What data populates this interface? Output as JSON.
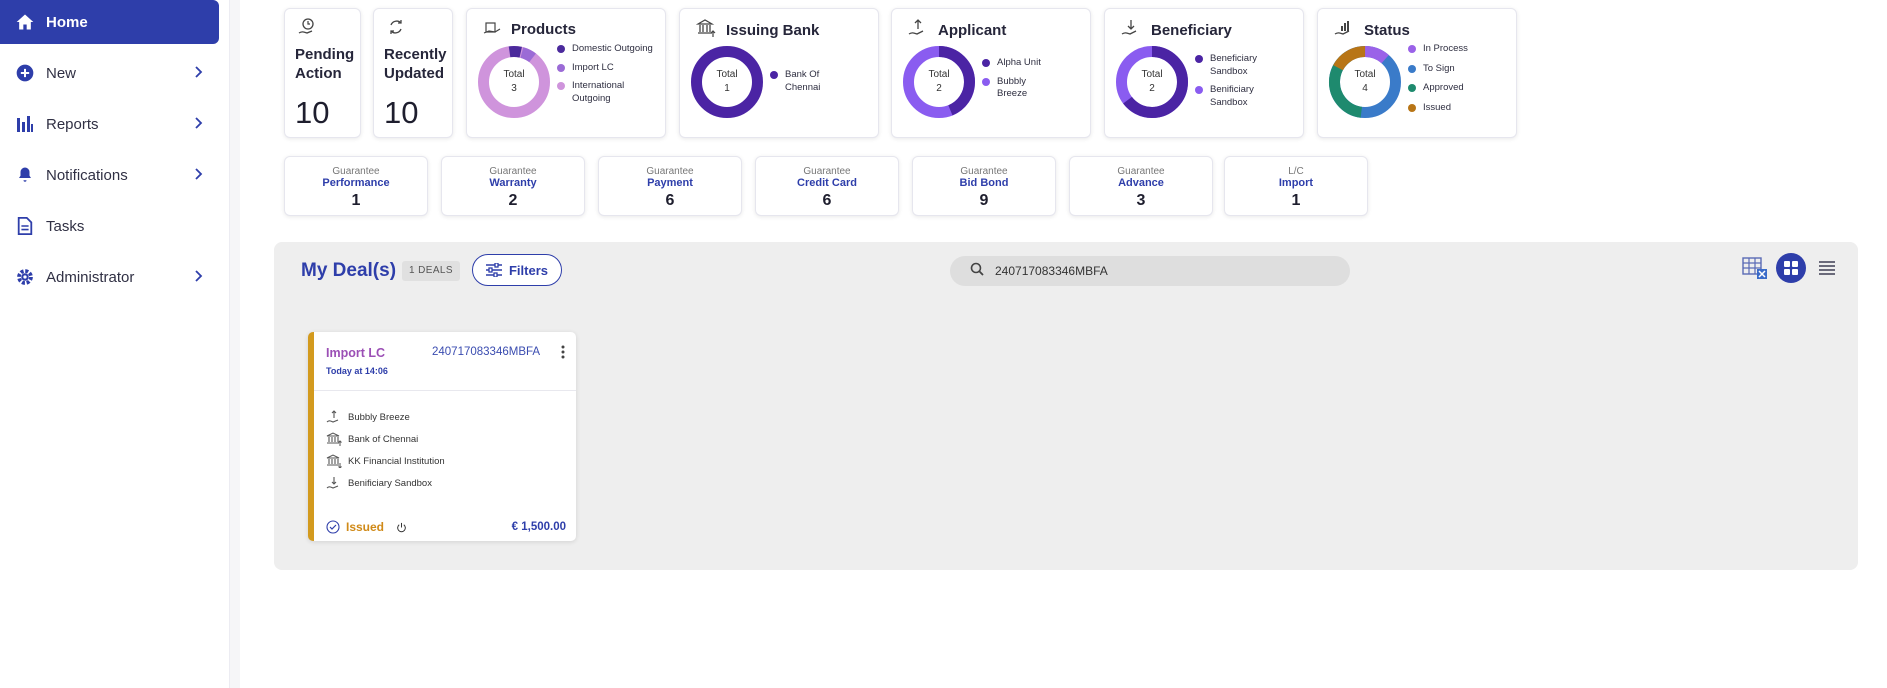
{
  "sidebar": {
    "items": [
      {
        "label": "Home",
        "icon": "home-icon",
        "active": true
      },
      {
        "label": "New",
        "icon": "plus-circle-icon"
      },
      {
        "label": "Reports",
        "icon": "bar-chart-icon"
      },
      {
        "label": "Notifications",
        "icon": "bell-icon"
      },
      {
        "label": "Tasks",
        "icon": "document-icon"
      },
      {
        "label": "Administrator",
        "icon": "gear-icon"
      }
    ]
  },
  "stats": {
    "pending": {
      "title_line1": "Pending",
      "title_line2": "Action",
      "value": "10"
    },
    "updated": {
      "title_line1": "Recently",
      "title_line2": "Updated",
      "value": "10"
    }
  },
  "charts": {
    "products": {
      "title": "Products",
      "total_label": "Total",
      "total": "3",
      "legend": [
        "Domestic Outgoing",
        "Import LC",
        "International Outgoing"
      ],
      "colors": [
        "#4b2a9c",
        "#9b6bd6",
        "#cf94dc"
      ]
    },
    "issuing_bank": {
      "title": "Issuing Bank",
      "total_label": "Total",
      "total": "1",
      "legend": [
        "Bank Of Chennai"
      ],
      "colors": [
        "#4b24a4"
      ]
    },
    "applicant": {
      "title": "Applicant",
      "total_label": "Total",
      "total": "2",
      "legend": [
        "Alpha Unit",
        "Bubbly Breeze"
      ],
      "colors": [
        "#4b24a4",
        "#8a5cf0"
      ]
    },
    "beneficiary": {
      "title": "Beneficiary",
      "total_label": "Total",
      "total": "2",
      "legend": [
        "Beneficiary Sandbox",
        "Benificiary Sandbox"
      ],
      "colors": [
        "#4b24a4",
        "#8a5cf0"
      ]
    },
    "status": {
      "title": "Status",
      "total_label": "Total",
      "total": "4",
      "legend": [
        "In Process",
        "To Sign",
        "Approved",
        "Issued"
      ],
      "colors": [
        "#9a62e8",
        "#3a7bc9",
        "#1e8a6e",
        "#b87516"
      ]
    }
  },
  "guarantees": [
    {
      "category": "Guarantee",
      "type": "Performance",
      "count": "1"
    },
    {
      "category": "Guarantee",
      "type": "Warranty",
      "count": "2"
    },
    {
      "category": "Guarantee",
      "type": "Payment",
      "count": "6"
    },
    {
      "category": "Guarantee",
      "type": "Credit Card",
      "count": "6"
    },
    {
      "category": "Guarantee",
      "type": "Bid Bond",
      "count": "9"
    },
    {
      "category": "Guarantee",
      "type": "Advance",
      "count": "3"
    },
    {
      "category": "L/C",
      "type": "Import",
      "count": "1"
    }
  ],
  "deals": {
    "title": "My Deal(s)",
    "count_badge": "1 DEALS",
    "filters_label": "Filters",
    "search_value": "240717083346MBFA",
    "card": {
      "type": "Import LC",
      "reference": "240717083346MBFA",
      "time": "Today at 14:06",
      "applicant": "Bubbly Breeze",
      "issuing_bank": "Bank of Chennai",
      "advising_bank": "KK Financial Institution",
      "beneficiary": "Benificiary Sandbox",
      "status": "Issued",
      "amount": "€ 1,500.00"
    }
  },
  "colors": {
    "primary": "#2e3eaa",
    "accent_gold": "#d39a1e",
    "purple": "#9b4fb5"
  }
}
